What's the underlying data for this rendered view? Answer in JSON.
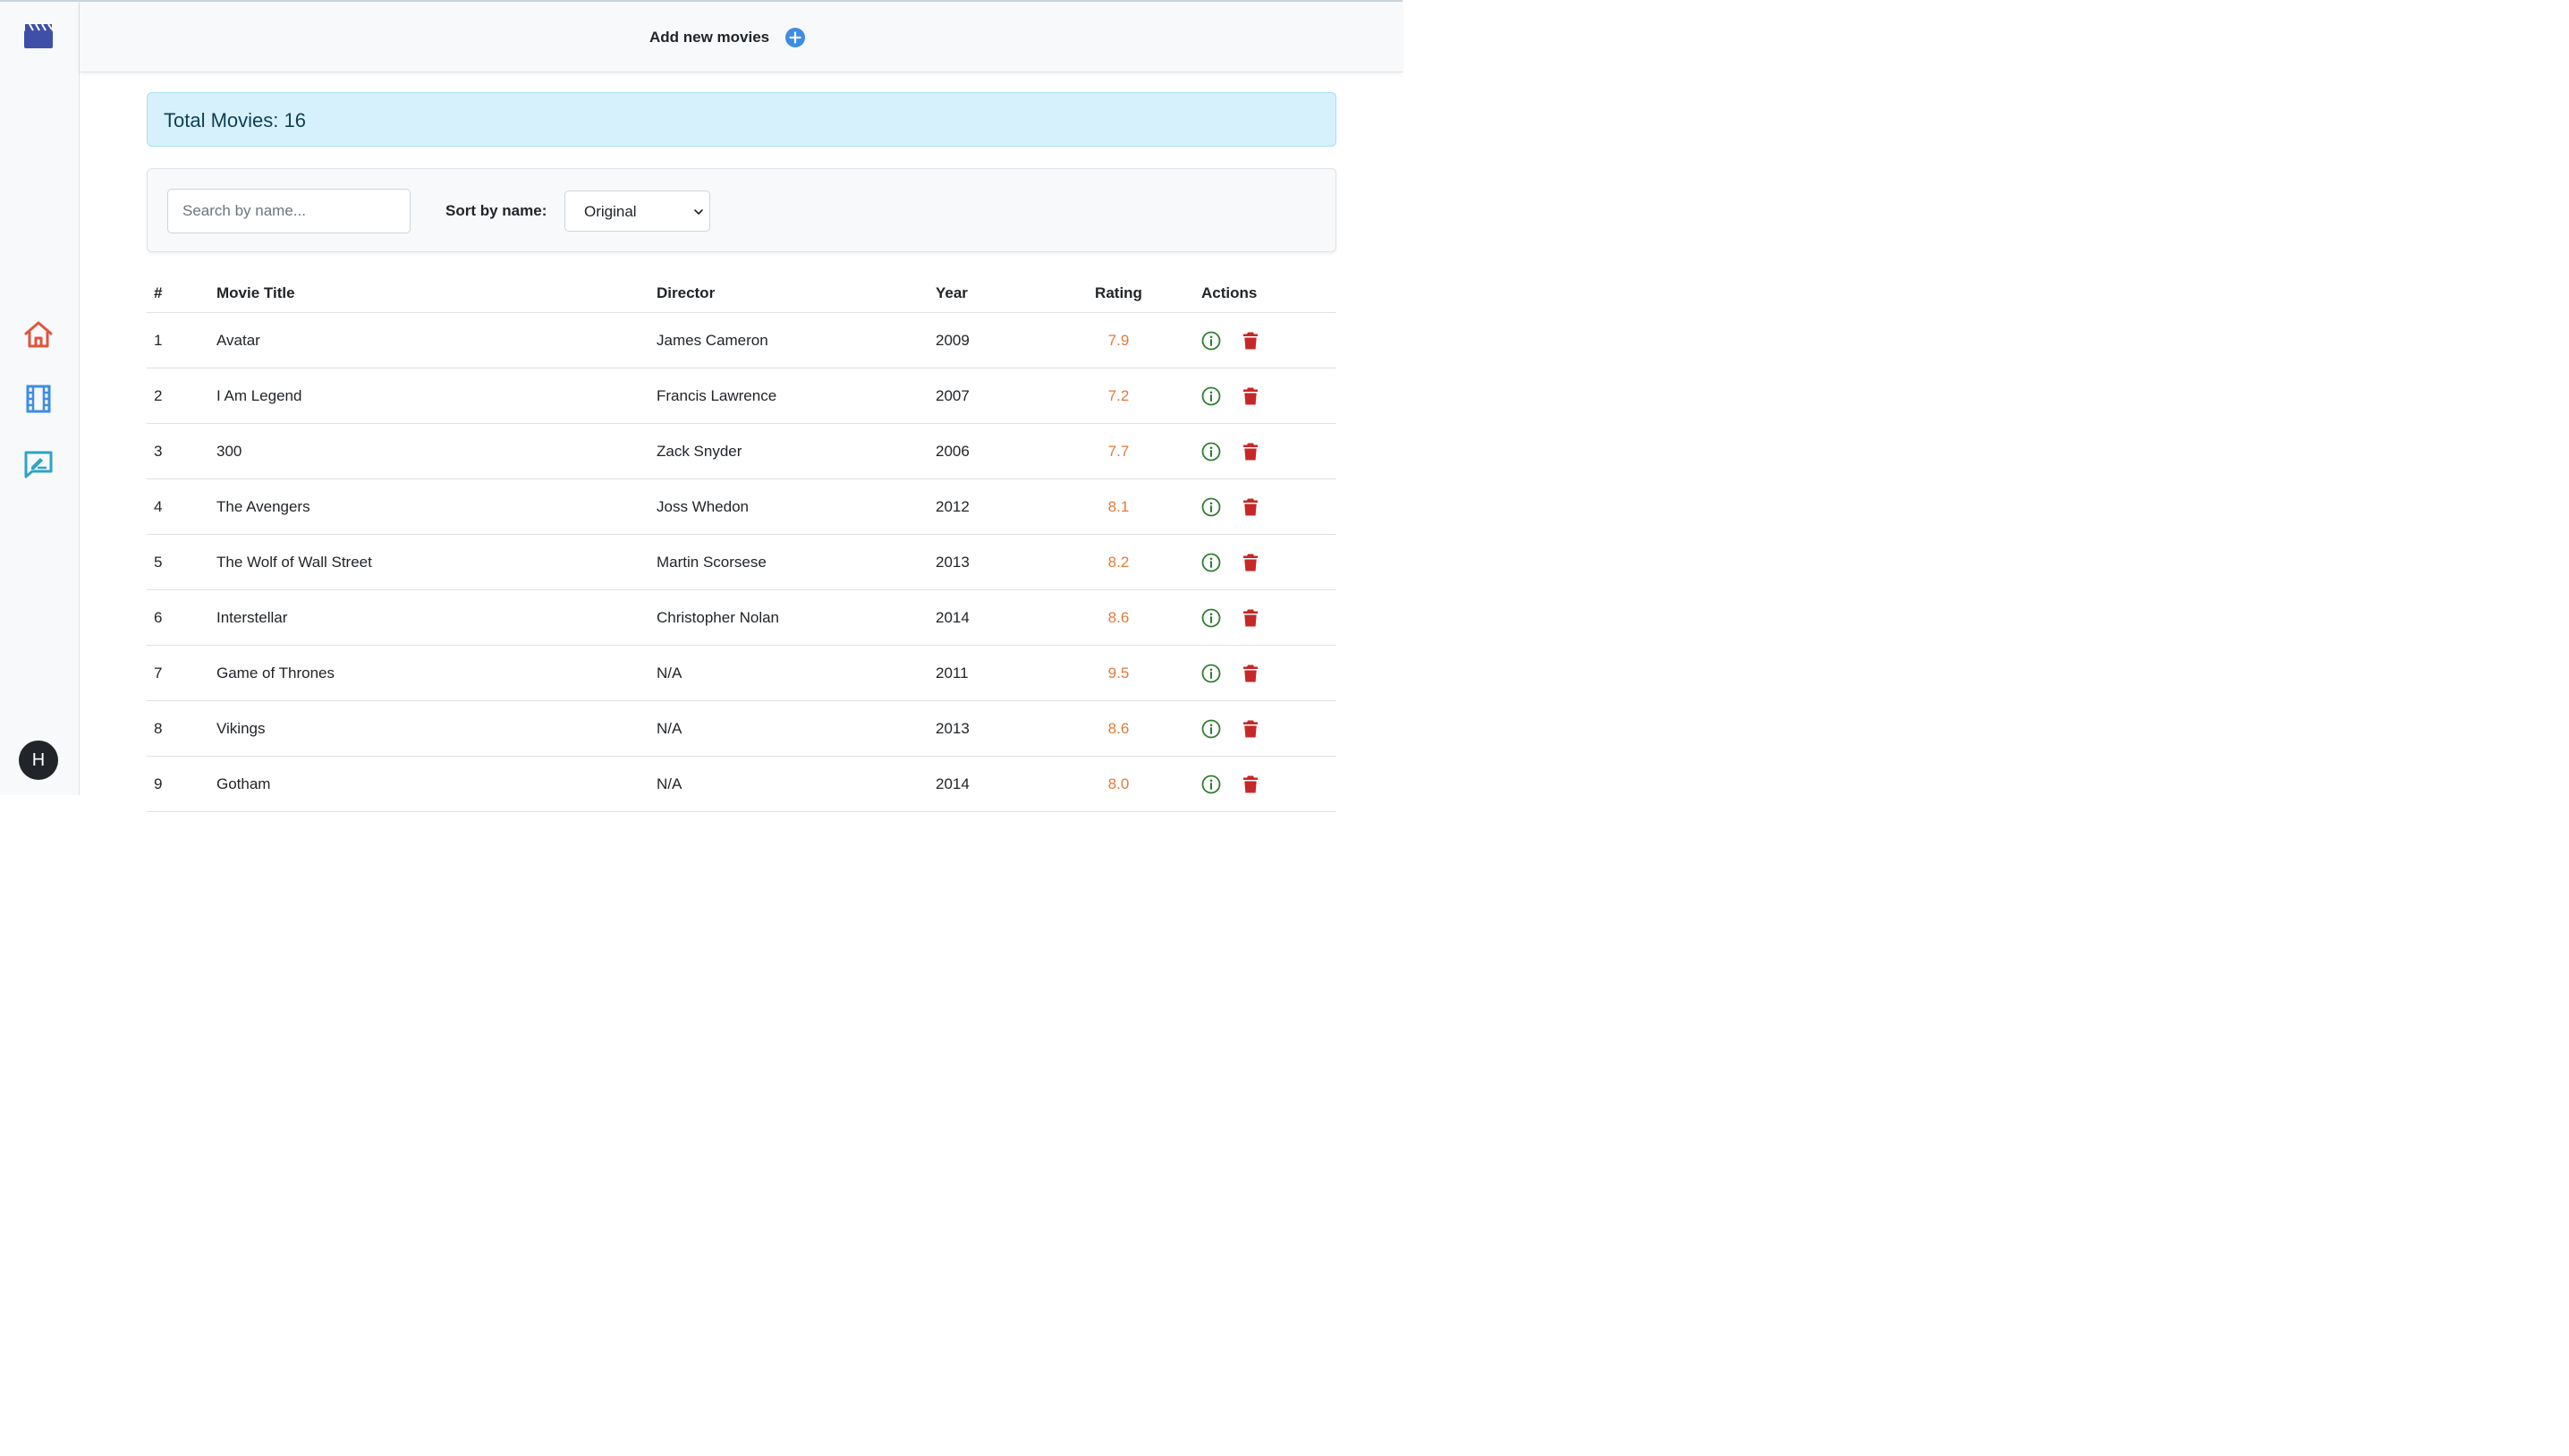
{
  "header": {
    "add_label": "Add new movies"
  },
  "summary": {
    "total_label": "Total Movies: 16"
  },
  "filters": {
    "search_placeholder": "Search by name...",
    "sort_label": "Sort by name:",
    "sort_value": "Original"
  },
  "user": {
    "initial": "H"
  },
  "table": {
    "headers": [
      "#",
      "Movie Title",
      "Director",
      "Year",
      "Rating",
      "Actions"
    ],
    "rows": [
      {
        "num": "1",
        "title": "Avatar",
        "director": "James Cameron",
        "year": "2009",
        "rating": "7.9"
      },
      {
        "num": "2",
        "title": "I Am Legend",
        "director": "Francis Lawrence",
        "year": "2007",
        "rating": "7.2"
      },
      {
        "num": "3",
        "title": "300",
        "director": "Zack Snyder",
        "year": "2006",
        "rating": "7.7"
      },
      {
        "num": "4",
        "title": "The Avengers",
        "director": "Joss Whedon",
        "year": "2012",
        "rating": "8.1"
      },
      {
        "num": "5",
        "title": "The Wolf of Wall Street",
        "director": "Martin Scorsese",
        "year": "2013",
        "rating": "8.2"
      },
      {
        "num": "6",
        "title": "Interstellar",
        "director": "Christopher Nolan",
        "year": "2014",
        "rating": "8.6"
      },
      {
        "num": "7",
        "title": "Game of Thrones",
        "director": "N/A",
        "year": "2011",
        "rating": "9.5"
      },
      {
        "num": "8",
        "title": "Vikings",
        "director": "N/A",
        "year": "2013",
        "rating": "8.6"
      },
      {
        "num": "9",
        "title": "Gotham",
        "director": "N/A",
        "year": "2014",
        "rating": "8.0"
      }
    ]
  },
  "icons": {
    "logo": "clapperboard-icon",
    "home": "home-icon",
    "movies": "film-icon",
    "reviews": "review-icon",
    "add": "plus-circle-icon",
    "info": "info-icon",
    "delete": "trash-icon",
    "sort": "chevron-down-icon"
  },
  "colors": {
    "logo": "#3f4fa8",
    "home": "#e0533d",
    "film": "#3d8de0",
    "review": "#2fa3c7",
    "add": "#3d8de0",
    "info": "#2e7d32",
    "delete": "#c62828",
    "rating": "#e07b39",
    "alert_bg": "#d6f1fb"
  }
}
